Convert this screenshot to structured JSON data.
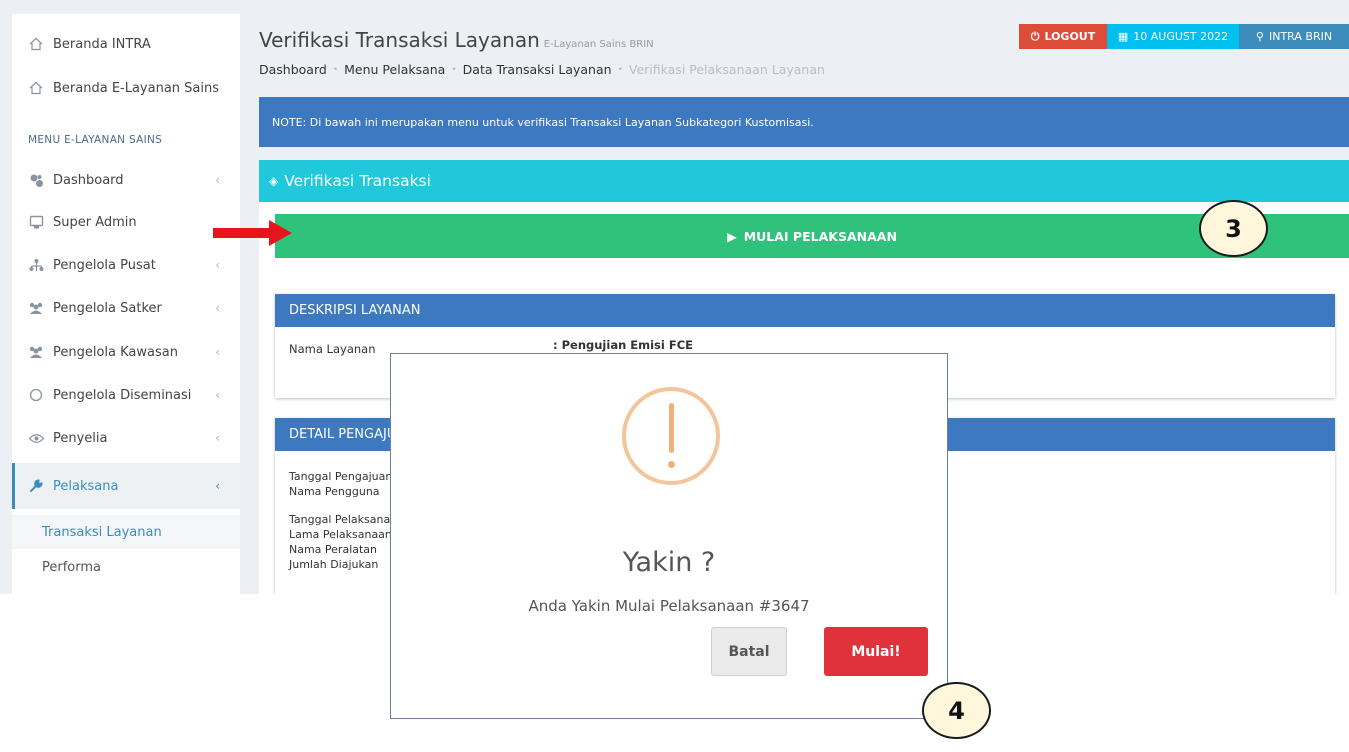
{
  "sidebar": {
    "top_links": [
      {
        "label": "Beranda INTRA",
        "icon": "home-icon"
      },
      {
        "label": "Beranda E-Layanan Sains",
        "icon": "home-icon"
      }
    ],
    "section_header": "MENU E-LAYANAN SAINS",
    "items": [
      {
        "label": "Dashboard",
        "icon": "dashboard-icon"
      },
      {
        "label": "Super Admin",
        "icon": "monitor-icon"
      },
      {
        "label": "Pengelola Pusat",
        "icon": "sitemap-icon"
      },
      {
        "label": "Pengelola Satker",
        "icon": "users-icon"
      },
      {
        "label": "Pengelola Kawasan",
        "icon": "users-icon"
      },
      {
        "label": "Pengelola Diseminasi",
        "icon": "circle-icon"
      },
      {
        "label": "Penyelia",
        "icon": "eye-icon"
      },
      {
        "label": "Pelaksana",
        "icon": "wrench-icon"
      }
    ],
    "sub_items": [
      "Transaksi Layanan",
      "Performa"
    ]
  },
  "header": {
    "title": "Verifikasi Transaksi Layanan",
    "subtitle": "E-Layanan Sains BRIN",
    "breadcrumb": [
      "Dashboard",
      "Menu Pelaksana",
      "Data Transaksi Layanan",
      "Verifikasi Pelaksanaan Layanan"
    ],
    "logout_label": "LOGOUT",
    "date_label": "10 AUGUST 2022",
    "intra_label": "INTRA BRIN"
  },
  "note": "NOTE: Di bawah ini merupakan menu untuk verifikasi Transaksi Layanan Subkategori Kustomisasi.",
  "card": {
    "title": "Verifikasi Transaksi",
    "start_button": "MULAI PELAKSANAAN",
    "desc_header": "DESKRIPSI LAYANAN",
    "desc_label": "Nama Layanan",
    "desc_value": ": Pengujian Emisi FCE",
    "detail_header": "DETAIL PENGAJUAN",
    "detail_labels": [
      "Tanggal Pengajuan",
      "Nama Pengguna",
      "Tanggal Pelaksanaan",
      "Lama Pelaksanaan",
      "Nama Peralatan",
      "Jumlah Diajukan"
    ]
  },
  "dialog": {
    "title": "Yakin ?",
    "text": "Anda Yakin Mulai Pelaksanaan #3647",
    "cancel_label": "Batal",
    "confirm_label": "Mulai!"
  },
  "annotations": {
    "step3": "3",
    "step4": "4"
  },
  "colors": {
    "success": "#2ec27a",
    "danger": "#e0323b",
    "info": "#1fc8db",
    "primary": "#3c79c1",
    "warning_icon": "#f0b07a"
  }
}
